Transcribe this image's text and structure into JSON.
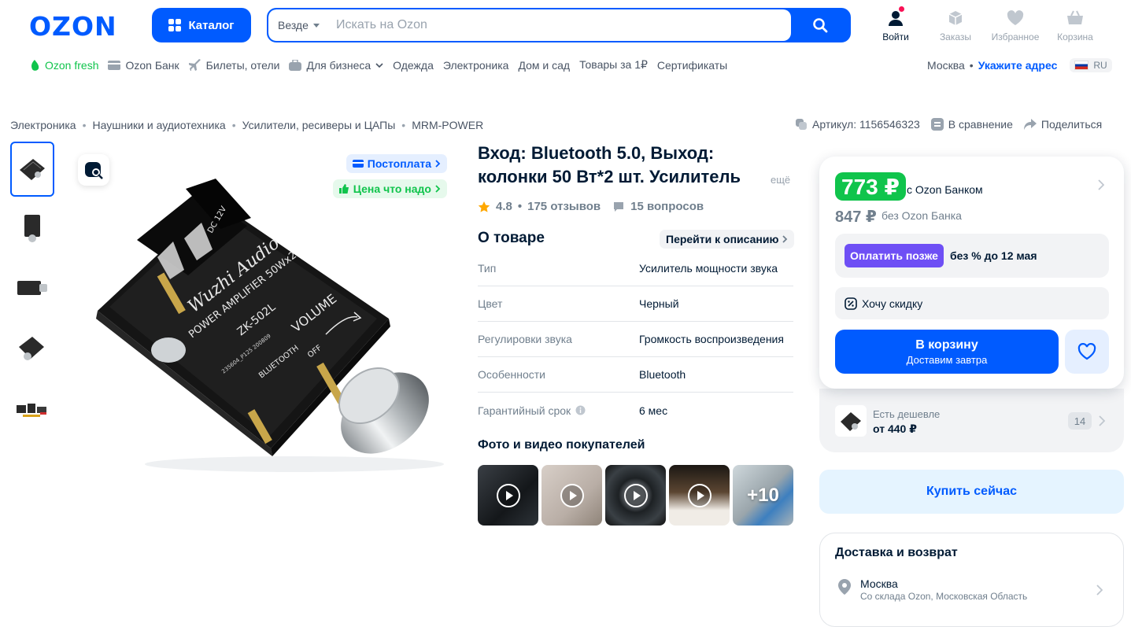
{
  "header": {
    "logo": "OZON",
    "catalog_label": "Каталог",
    "search": {
      "scope": "Везде",
      "placeholder": "Искать на Ozon"
    },
    "actions": [
      {
        "label": "Войти",
        "icon": "user-icon"
      },
      {
        "label": "Заказы",
        "icon": "box-icon"
      },
      {
        "label": "Избранное",
        "icon": "heart-icon"
      },
      {
        "label": "Корзина",
        "icon": "cart-icon"
      }
    ]
  },
  "nav": {
    "items": [
      "Ozon fresh",
      "Ozon Банк",
      "Билеты, отели",
      "Для бизнеса",
      "Одежда",
      "Электроника",
      "Дом и сад",
      "Товары за 1₽",
      "Сертификаты"
    ],
    "city": "Москва",
    "address_link": "Укажите адрес",
    "language": "RU"
  },
  "breadcrumbs": [
    "Электроника",
    "Наушники и аудиотехника",
    "Усилители, ресиверы и ЦАПы",
    "MRM-POWER"
  ],
  "meta": {
    "article": "Артикул: 1156546323",
    "compare": "В сравнение",
    "share": "Поделиться"
  },
  "gallery": {
    "badges": {
      "postpay": "Постоплата",
      "fair_price": "Цена что надо"
    },
    "board_text": {
      "brand": "Wuzhi Audio",
      "spec": "POWER AMPLIFIER 50Wx2",
      "model": "ZK-502L",
      "volume": "VOLUME",
      "off": "OFF",
      "bt": "BLUETOOTH",
      "pcb": "235604_P125 200809",
      "dc": "DC 12V"
    }
  },
  "product": {
    "title": "Вход: Bluetooth 5.0, Выход: колонки 50 Вт*2 шт. Усилитель",
    "more": "ещё",
    "rating": "4.8",
    "reviews": "175 отзывов",
    "questions": "15 вопросов"
  },
  "about": {
    "title": "О товаре",
    "go_to_description": "Перейти к описанию",
    "specs": [
      {
        "key": "Тип",
        "value": "Усилитель мощности звука"
      },
      {
        "key": "Цвет",
        "value": "Черный"
      },
      {
        "key": "Регулировки звука",
        "value": "Громкость воспроизведения"
      },
      {
        "key": "Особенности",
        "value": "Bluetooth"
      },
      {
        "key": "Гарантийный срок",
        "value": "6 мес"
      }
    ]
  },
  "ugc": {
    "title": "Фото и видео покупателей",
    "more": "+10"
  },
  "buy": {
    "price_card": "773 ₽",
    "price_card_note": "с Ozon Банком",
    "price_regular": "847 ₽",
    "price_regular_note": "без Ozon Банка",
    "pay_later_tag": "Оплатить позже",
    "pay_later_text": "без % до 12 мая",
    "discount": "Хочу скидку",
    "cart_label": "В корзину",
    "cart_sub": "Доставим завтра",
    "cheaper_label": "Есть дешевле",
    "cheaper_price": "от 440 ₽",
    "cheaper_count": "14",
    "buy_now": "Купить сейчас"
  },
  "delivery": {
    "title": "Доставка и возврат",
    "city": "Москва",
    "source": "Со склада Ozon, Московская Область"
  },
  "colors": {
    "brand": "#005bff",
    "green": "#10c44c",
    "purple": "#6e4ff5",
    "text": "#001a34",
    "muted": "#707f8d"
  }
}
